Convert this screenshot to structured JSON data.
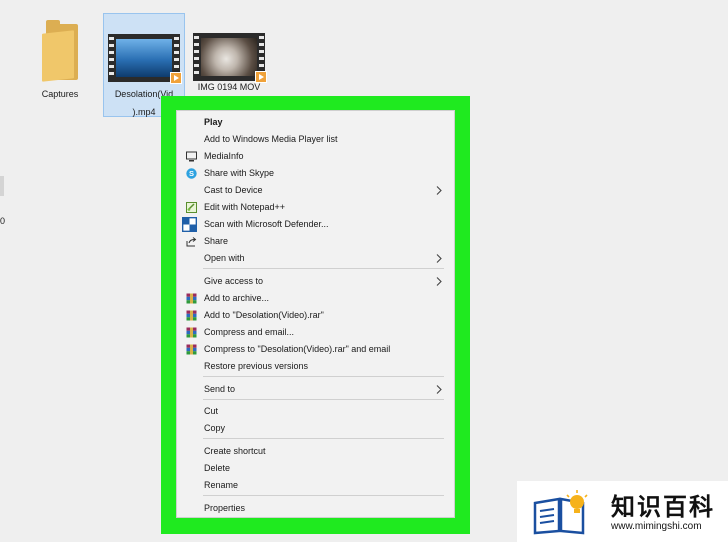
{
  "desktop": {
    "left_edge_char": "0",
    "files": [
      {
        "name": "Captures"
      },
      {
        "name": "Desolation(Video).mp4",
        "line1": "Desolation(Vid",
        "line2": ").mp4"
      },
      {
        "name": "IMG_0194.MOV",
        "line1": "IMG 0194 MOV"
      }
    ]
  },
  "context_menu": {
    "items": [
      {
        "label": "Play",
        "icon": null,
        "bold": true
      },
      {
        "label": "Add to Windows Media Player list",
        "icon": null
      },
      {
        "label": "MediaInfo",
        "icon": "mediainfo-icon"
      },
      {
        "label": "Share with Skype",
        "icon": "skype-icon"
      },
      {
        "label": "Cast to Device",
        "icon": null,
        "submenu": true
      },
      {
        "label": "Edit with Notepad++",
        "icon": "notepadpp-icon"
      },
      {
        "label": "Scan with Microsoft Defender...",
        "icon": "defender-icon"
      },
      {
        "label": "Share",
        "icon": "share-icon"
      },
      {
        "label": "Open with",
        "icon": null,
        "submenu": true
      },
      {
        "label": "Give access to",
        "icon": null,
        "submenu": true
      },
      {
        "label": "Add to archive...",
        "icon": "winrar-icon"
      },
      {
        "label": "Add to \"Desolation(Video).rar\"",
        "icon": "winrar-icon"
      },
      {
        "label": "Compress and email...",
        "icon": "winrar-icon"
      },
      {
        "label": "Compress to \"Desolation(Video).rar\" and email",
        "icon": "winrar-icon"
      },
      {
        "label": "Restore previous versions",
        "icon": null
      },
      {
        "label": "Send to",
        "icon": null,
        "submenu": true
      },
      {
        "label": "Cut",
        "icon": null
      },
      {
        "label": "Copy",
        "icon": null
      },
      {
        "label": "Create shortcut",
        "icon": null
      },
      {
        "label": "Delete",
        "icon": null
      },
      {
        "label": "Rename",
        "icon": null
      },
      {
        "label": "Properties",
        "icon": null
      }
    ]
  },
  "colors": {
    "highlight_frame": "#1fea1f",
    "selection": "#cde1f5",
    "menu_bg": "#f2f2f2"
  },
  "watermark": {
    "title": "知识百科",
    "url": "www.mimingshi.com"
  }
}
